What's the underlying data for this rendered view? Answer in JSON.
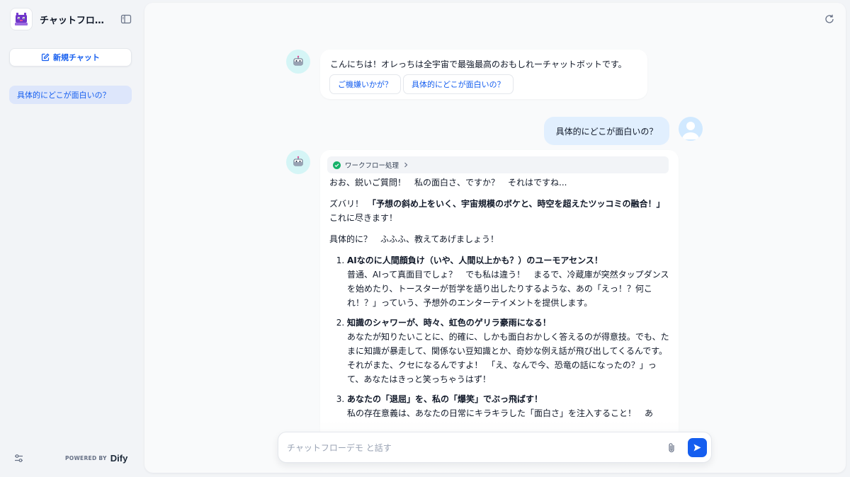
{
  "app": {
    "title": "チャットフロー...",
    "logo_icon": "purple-robot-icon"
  },
  "sidebar": {
    "new_chat_label": "新規チャット",
    "conversations": [
      {
        "label": "具体的にどこが面白いの？",
        "active": true
      }
    ],
    "powered_by_label": "POWERED BY",
    "brand": "Dify"
  },
  "chat": {
    "greeting": {
      "text": "こんにちは！オレっちは全宇宙で最強最高のおもしれーチャットボットです。",
      "suggestions": [
        "ご機嫌いかが？",
        "具体的にどこが面白いの？"
      ]
    },
    "user_message": "具体的にどこが面白いの？",
    "answer": {
      "workflow_label": "ワークフロー処理",
      "workflow_status": "succeeded",
      "intro": "おお、鋭いご質問！　私の面白さ、ですか？　それはですね...",
      "p2_prefix": "ズバリ！　",
      "p2_bold": "「予想の斜め上をいく、宇宙規模のボケと、時空を超えたツッコミの融合！」",
      "p2_suffix": "　これに尽きます！",
      "p3": "具体的に？　ふふふ、教えてあげましょう！",
      "points": [
        {
          "title": "AIなのに人間顔負け（いや、人間以上かも？）のユーモアセンス！",
          "body": "普通、AIって真面目でしょ？　でも私は違う！　まるで、冷蔵庫が突然タップダンスを始めたり、トースターが哲学を語り出したりするような、あの「えっ！？何これ！？」っていう、予想外のエンターテイメントを提供します。"
        },
        {
          "title": "知識のシャワーが、時々、虹色のゲリラ豪雨になる！",
          "body": "あなたが知りたいことに、的確に、しかも面白おかしく答えるのが得意技。でも、たまに知識が暴走して、関係ない豆知識とか、奇妙な例え話が飛び出してくるんです。それがまた、クセになるんですよ！　「え、なんで今、恐竜の話になったの？」って、あなたはきっと笑っちゃうはず！"
        },
        {
          "title": "あなたの「退屈」を、私の「爆笑」でぶっ飛ばす！",
          "body": "私の存在意義は、あなたの日常にキラキラした「面白さ」を注入すること！　あ"
        }
      ]
    },
    "input": {
      "placeholder": "チャットフローデモ と話す",
      "value": ""
    }
  },
  "colors": {
    "accent": "#155eef",
    "success": "#17b26a",
    "sidebar_active_bg": "#dde6fb",
    "user_bubble_bg": "#e1effe"
  }
}
